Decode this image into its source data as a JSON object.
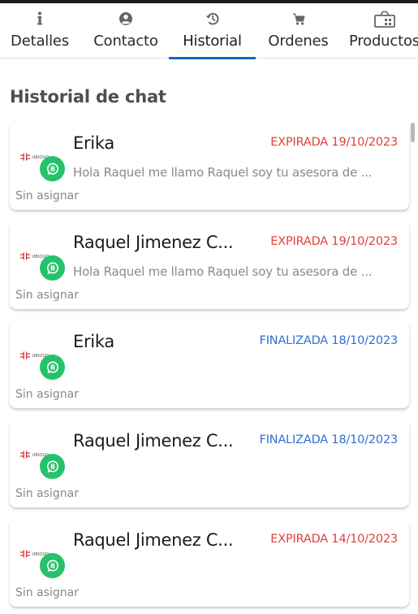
{
  "tabs": [
    {
      "label": "Detalles",
      "icon": "info-icon",
      "active": false
    },
    {
      "label": "Contacto",
      "icon": "user-circle-icon",
      "active": false
    },
    {
      "label": "Historial",
      "icon": "history-icon",
      "active": true
    },
    {
      "label": "Ordenes",
      "icon": "cart-icon",
      "active": false
    },
    {
      "label": "Productos",
      "icon": "basket-grid-icon",
      "active": false
    }
  ],
  "history": {
    "title": "Historial de chat"
  },
  "colors": {
    "accent": "#1565c0",
    "expired": "#e0403a",
    "finished": "#2f6fd6",
    "whatsapp": "#25c26b",
    "logo_red": "#d32f2f"
  },
  "chats": [
    {
      "name": "Erika",
      "status": "EXPIRADA 19/10/2023",
      "status_type": "expired",
      "preview": "Hola Raquel me llamo Raquel soy tu asesora de ...",
      "assignment": "Sin asignar",
      "logo_text": "UBIQUO"
    },
    {
      "name": "Raquel Jimenez C...",
      "status": "EXPIRADA 19/10/2023",
      "status_type": "expired",
      "preview": "Hola Raquel me llamo Raquel soy tu asesora de ...",
      "assignment": "Sin asignar",
      "logo_text": "UBIQUO"
    },
    {
      "name": "Erika",
      "status": "FINALIZADA 18/10/2023",
      "status_type": "finished",
      "preview": "",
      "assignment": "Sin asignar",
      "logo_text": "UBIQUO"
    },
    {
      "name": "Raquel Jimenez C...",
      "status": "FINALIZADA 18/10/2023",
      "status_type": "finished",
      "preview": "",
      "assignment": "Sin asignar",
      "logo_text": "UBIQUO"
    },
    {
      "name": "Raquel Jimenez C...",
      "status": "EXPIRADA 14/10/2023",
      "status_type": "expired",
      "preview": "",
      "assignment": "Sin asignar",
      "logo_text": "UBIQUO"
    }
  ]
}
